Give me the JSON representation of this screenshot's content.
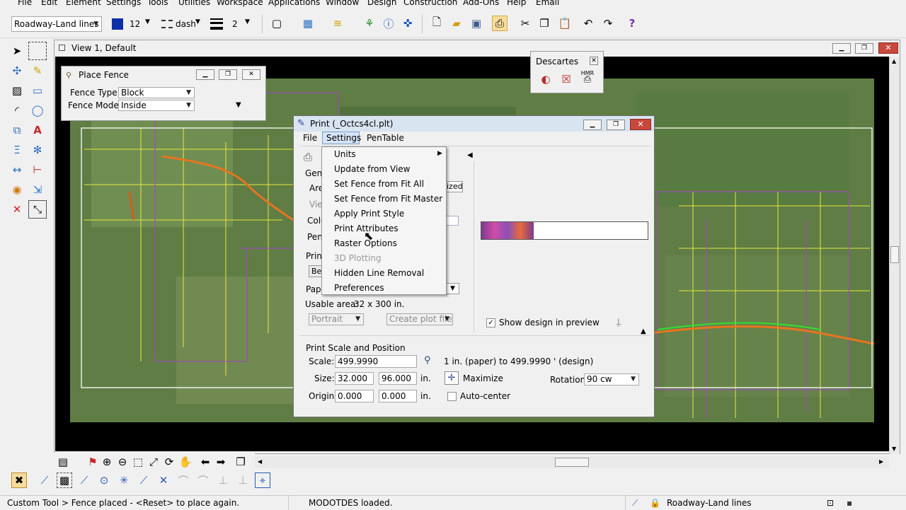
{
  "menubar": {
    "items": [
      "File",
      "Edit",
      "Element",
      "Settings",
      "Tools",
      "Utilities",
      "Workspace",
      "Applications",
      "Window",
      "Design",
      "Construction",
      "Add-Ons",
      "Help",
      "Email"
    ]
  },
  "attributes": {
    "level": "Roadway-Land lines",
    "color_value": "12",
    "style": "dash",
    "weight": "2"
  },
  "view": {
    "title": "View 1, Default"
  },
  "place_fence": {
    "title": "Place Fence",
    "type_label": "Fence Type:",
    "type_value": "Block",
    "mode_label": "Fence Mode:",
    "mode_value": "Inside"
  },
  "descartes": {
    "title": "Descartes",
    "tool3_label": "HMR"
  },
  "print": {
    "title": "Print  (_Octcs4cl.plt)",
    "menu": [
      "File",
      "Settings",
      "PenTable"
    ],
    "left_labels": [
      "Gene",
      "Area",
      "View",
      "Colo",
      "Pen",
      "Printe",
      "Be",
      "Pape"
    ],
    "area_tail": "ized",
    "usable_area_label": "Usable area:",
    "usable_area_value": "32 x 300 in.",
    "orientation": "Portrait",
    "create_plot_file": "Create plot file",
    "show_design_label": "Show design in preview",
    "show_design_checked": true,
    "scale_section_title": "Print Scale and Position",
    "scale_label": "Scale:",
    "scale_value": "499.9990",
    "scale_text": "1 in. (paper) to 499.9990 ' (design)",
    "size_label": "Size:",
    "size_w": "32.000",
    "size_h": "96.000",
    "size_unit": "in.",
    "maximize_label": "Maximize",
    "rotation_label": "Rotation:",
    "rotation_value": "90 cw",
    "origin_label": "Origin:",
    "origin_x": "0.000",
    "origin_y": "0.000",
    "origin_unit": "in.",
    "autocenter_label": "Auto-center",
    "autocenter_checked": false
  },
  "settings_menu": {
    "items": [
      "Units",
      "Update from View",
      "Set Fence from Fit All",
      "Set Fence from Fit Master",
      "Apply Print Style",
      "Print Attributes",
      "Raster Options",
      "3D Plotting",
      "Hidden Line Removal",
      "Preferences"
    ],
    "disabled_items": [
      "3D Plotting"
    ]
  },
  "status": {
    "prompt": "Custom Tool > Fence placed - <Reset> to place again.",
    "message": "MODOTDES loaded.",
    "active_level": "Roadway-Land lines"
  },
  "colors": {
    "menu_bg": "#f0f0f0",
    "canvas_bg": "#000000",
    "close_red": "#c9483c",
    "title_active": "#d9e4f1",
    "fence_line": "#ffffff",
    "parcel_yellow": "#e6e640",
    "parcel_purple": "#9a4fb0",
    "road_orange": "#e8741e"
  }
}
